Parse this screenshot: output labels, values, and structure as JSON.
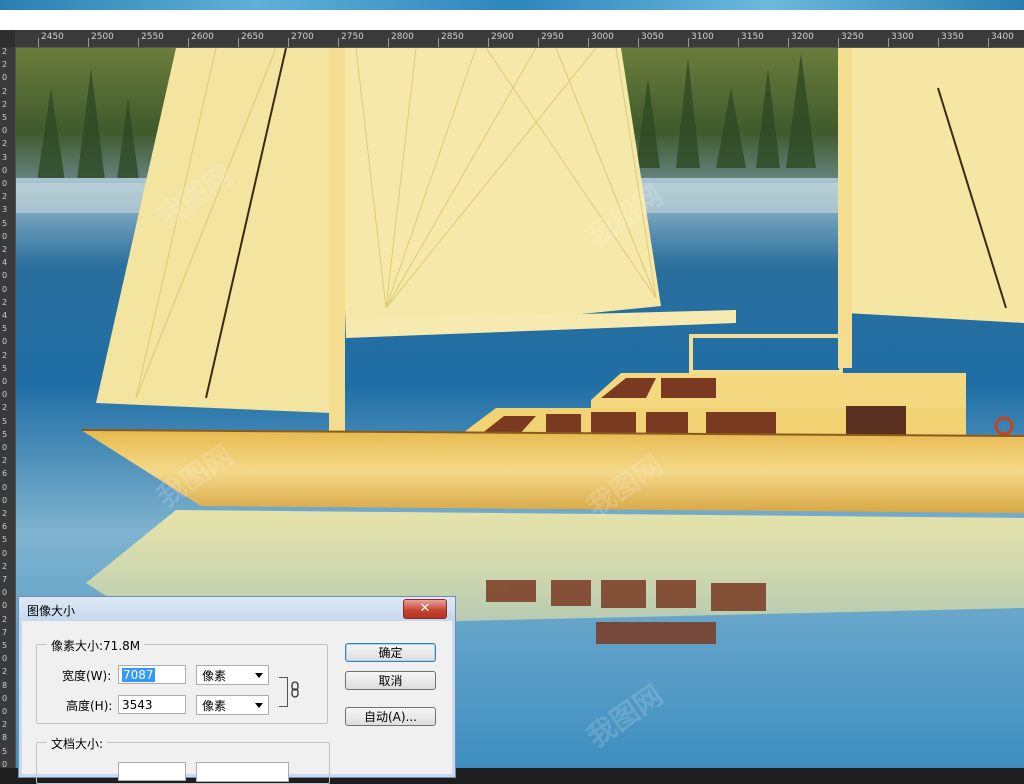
{
  "ruler": {
    "h_ticks": [
      "2450",
      "2500",
      "2550",
      "2600",
      "2650",
      "2700",
      "2750",
      "2800",
      "2850",
      "2900",
      "2950",
      "3000",
      "3050",
      "3100",
      "3150",
      "3200",
      "3250",
      "3300",
      "3350",
      "3400"
    ],
    "v_ticks": [
      "2",
      "2",
      "0",
      "2",
      "2",
      "5",
      "0",
      "2",
      "3",
      "0",
      "0",
      "2",
      "3",
      "5",
      "0",
      "2",
      "4",
      "0",
      "0",
      "2",
      "4",
      "5",
      "0",
      "2",
      "5",
      "0",
      "0",
      "2",
      "5",
      "5",
      "0",
      "2",
      "6",
      "0",
      "0",
      "2",
      "6",
      "5",
      "0",
      "2",
      "7",
      "0",
      "0",
      "2",
      "7",
      "5",
      "0",
      "2",
      "8",
      "0",
      "0",
      "2",
      "8",
      "5",
      "0"
    ]
  },
  "dialog": {
    "title": "图像大小",
    "close": "✕",
    "pixel_group": "像素大小:71.8M",
    "width_label": "宽度(W):",
    "width_value": "7087",
    "width_unit": "像素",
    "height_label": "高度(H):",
    "height_value": "3543",
    "height_unit": "像素",
    "doc_group": "文档大小:",
    "ok": "确定",
    "cancel": "取消",
    "auto": "自动(A)..."
  },
  "icons": {
    "chain": "link-icon",
    "dropdown": "chevron-down-icon"
  },
  "colors": {
    "ruler_bg": "#3a3a3a",
    "sail": "#f3e4a0",
    "water": "#2c7fb5",
    "dialog_bg": "#f0f0f0",
    "close_red": "#c4412f",
    "selection": "#3399ff"
  }
}
